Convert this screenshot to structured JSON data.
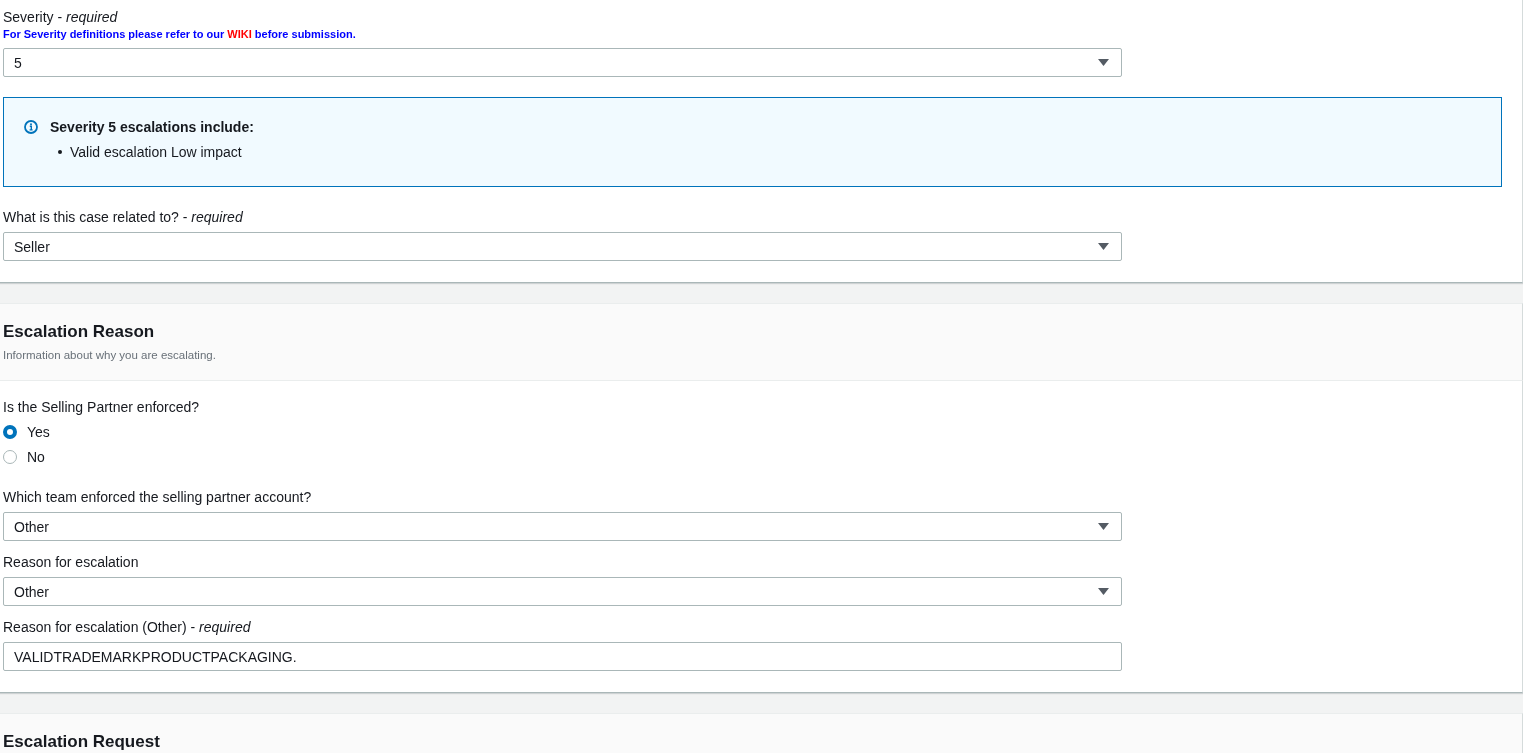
{
  "sections": [
    {
      "kind": "plain",
      "fields": [
        {
          "kind": "select",
          "label": "Severity - *required*",
          "note": {
            "text": "For Severity definitions please refer to our",
            "link": "WIKI",
            "after": "before submission."
          },
          "value": "5"
        },
        {
          "kind": "alert",
          "title": "Severity 5 escalations include:",
          "items": [
            "Valid escalation Low impact"
          ]
        },
        {
          "kind": "select",
          "label": "What is this case related to? - *required*",
          "value": "Seller"
        }
      ]
    },
    {
      "kind": "titled",
      "title": "Escalation Reason",
      "description": "Information about why you are escalating.",
      "fields": [
        {
          "kind": "radio",
          "label": "Is the Selling Partner enforced?",
          "options": [
            {
              "label": "Yes",
              "selected": true
            },
            {
              "label": "No",
              "selected": false
            }
          ]
        },
        {
          "kind": "select",
          "label": "Which team enforced the selling partner account?",
          "value": "Other"
        },
        {
          "kind": "select",
          "label": "Reason for escalation",
          "value": "Other"
        },
        {
          "kind": "text",
          "label": "Reason for escalation (Other) - *required*",
          "value": "VALIDTRADEMARKPRODUCTPACKAGING."
        }
      ]
    },
    {
      "kind": "titled",
      "title": "Escalation Request"
    }
  ]
}
